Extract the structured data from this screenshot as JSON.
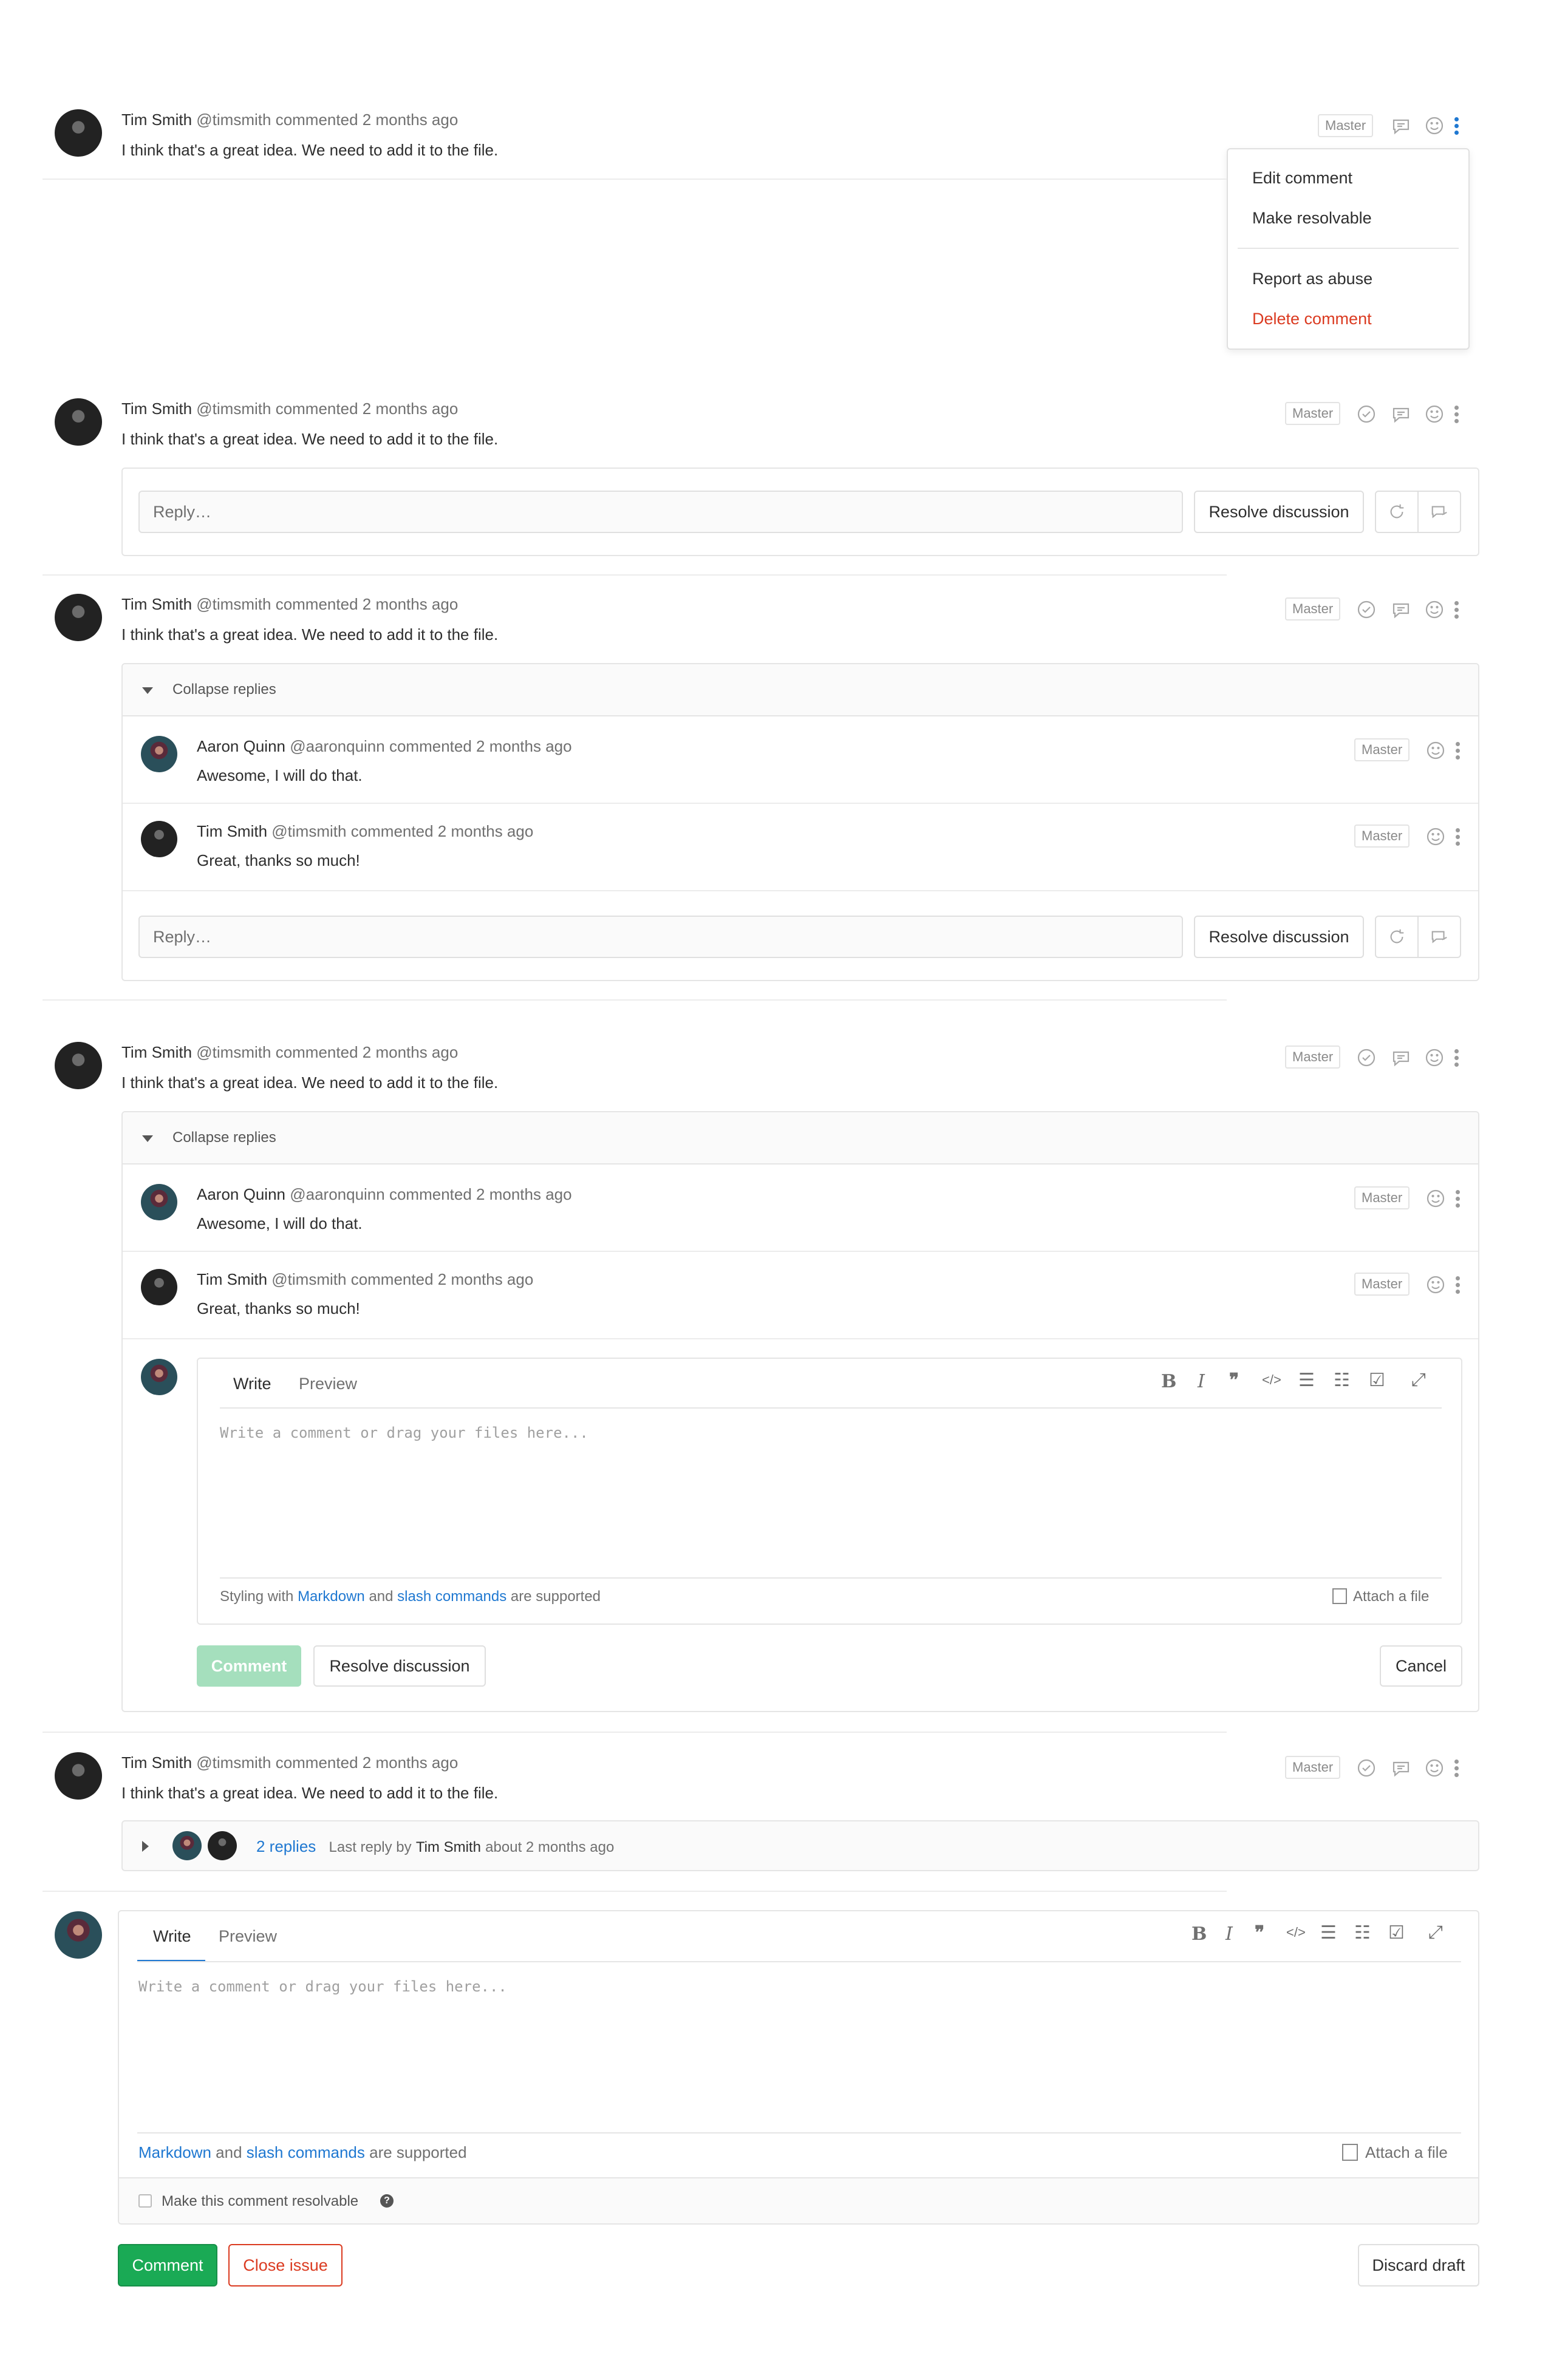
{
  "dropdown": {
    "items": [
      "Edit comment",
      "Make resolvable",
      "Report as abuse",
      "Delete comment"
    ]
  },
  "note": {
    "author": "Tim Smith",
    "handle": "@timsmith",
    "action": "commented",
    "time": "2 months ago",
    "text": "I think that's a great idea. We need to add it to the file."
  },
  "reply_aaron": {
    "author": "Aaron Quinn",
    "handle": "@aaronquinn",
    "action": "commented",
    "time": "2 months ago",
    "text": "Awesome, I will do that."
  },
  "reply_tim": {
    "author": "Tim Smith",
    "handle": "@timsmith",
    "action": "commented",
    "time": "2 months ago",
    "text": "Great, thanks so much!"
  },
  "badge": "Master",
  "reply_placeholder": "Reply…",
  "resolve_label": "Resolve discussion",
  "collapse_label": "Collapse replies",
  "editor": {
    "write_tab": "Write",
    "preview_tab": "Preview",
    "placeholder": "Write a comment or drag your files here...",
    "styling_prefix": "Styling with",
    "markdown": "Markdown",
    "and": "and",
    "slash_commands": "slash commands",
    "supported": "are supported",
    "attach": "Attach a file",
    "comment_btn": "Comment",
    "cancel_btn": "Cancel"
  },
  "collapsed": {
    "replies": "2 replies",
    "last_reply_prefix": "Last reply by",
    "last_reply_author": "Tim Smith",
    "last_reply_time": "about 2 months ago"
  },
  "main_form": {
    "resolvable_label": "Make this comment resolvable",
    "comment_btn": "Comment",
    "close_btn": "Close issue",
    "discard_btn": "Discard draft"
  },
  "colors": {
    "accent": "#1f78d1",
    "success": "#1aaa55",
    "danger": "#db3b21"
  }
}
